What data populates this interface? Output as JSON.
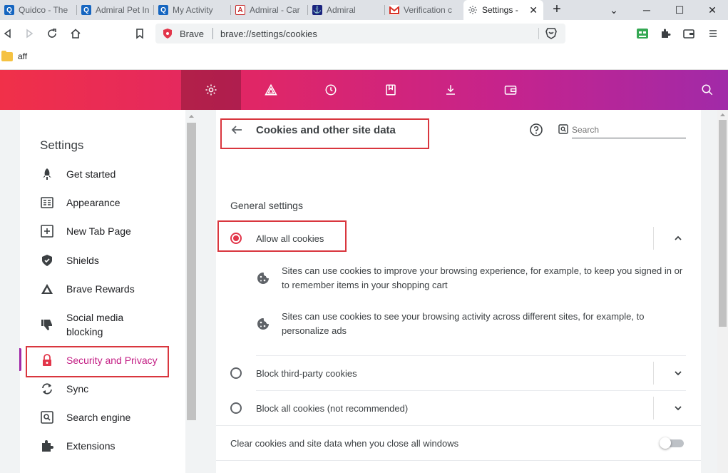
{
  "browser": {
    "tabs": [
      {
        "title": "Quidco - The",
        "favicon": "quidco-q-icon",
        "active": false
      },
      {
        "title": "Admiral Pet In",
        "favicon": "quidco-q-icon",
        "active": false
      },
      {
        "title": "My Activity",
        "favicon": "quidco-q-icon",
        "active": false
      },
      {
        "title": "Admiral - Car",
        "favicon": "admiral-logo-icon",
        "active": false
      },
      {
        "title": "Admiral",
        "favicon": "admiral-crest-icon",
        "active": false
      },
      {
        "title": "Verification c",
        "favicon": "gmail-icon",
        "active": false
      },
      {
        "title": "Settings -",
        "favicon": "gear-icon",
        "active": true
      }
    ],
    "new_tab_symbol": "+",
    "window_controls": {
      "tablist": "⌄",
      "minimize": "─",
      "maximize": "☐",
      "close": "✕"
    },
    "omnibox": {
      "brand": "Brave",
      "url": "brave://settings/cookies"
    },
    "bookmarks": [
      {
        "label": "aff",
        "icon": "folder-icon"
      }
    ]
  },
  "header_icons": [
    "gear-icon",
    "rewards-triangle-icon",
    "history-icon",
    "bookmarks-icon",
    "download-icon",
    "wallet-icon"
  ],
  "sidebar": {
    "title": "Settings",
    "items": [
      {
        "label": "Get started",
        "icon": "rocket-icon"
      },
      {
        "label": "Appearance",
        "icon": "appearance-icon"
      },
      {
        "label": "New Tab Page",
        "icon": "new-tab-icon"
      },
      {
        "label": "Shields",
        "icon": "shield-icon"
      },
      {
        "label": "Brave Rewards",
        "icon": "rewards-triangle-icon"
      },
      {
        "label": "Social media",
        "label2": "blocking",
        "icon": "thumbs-down-icon"
      },
      {
        "label": "Security and Privacy",
        "icon": "lock-icon",
        "active": true
      },
      {
        "label": "Sync",
        "icon": "sync-icon"
      },
      {
        "label": "Search engine",
        "icon": "search-engine-icon"
      },
      {
        "label": "Extensions",
        "icon": "puzzle-icon"
      }
    ]
  },
  "main": {
    "page_title": "Cookies and other site data",
    "search_placeholder": "Search",
    "section_title": "General settings",
    "options": [
      {
        "label": "Allow all cookies",
        "selected": true,
        "expanded": true
      },
      {
        "label": "Block third-party cookies",
        "selected": false,
        "expanded": false
      },
      {
        "label": "Block all cookies (not recommended)",
        "selected": false,
        "expanded": false
      }
    ],
    "descriptions": [
      "Sites can use cookies to improve your browsing experience, for example, to keep you signed in or to remember items in your shopping cart",
      "Sites can use cookies to see your browsing activity across different sites, for example, to personalize ads"
    ],
    "clear_on_exit": {
      "label": "Clear cookies and site data when you close all windows",
      "enabled": false
    }
  },
  "colors": {
    "accent": "#c31e84",
    "radio": "#e2364a",
    "highlight_box": "#d9363e",
    "header_gradient": [
      "#f03049",
      "#a12aa8"
    ]
  }
}
